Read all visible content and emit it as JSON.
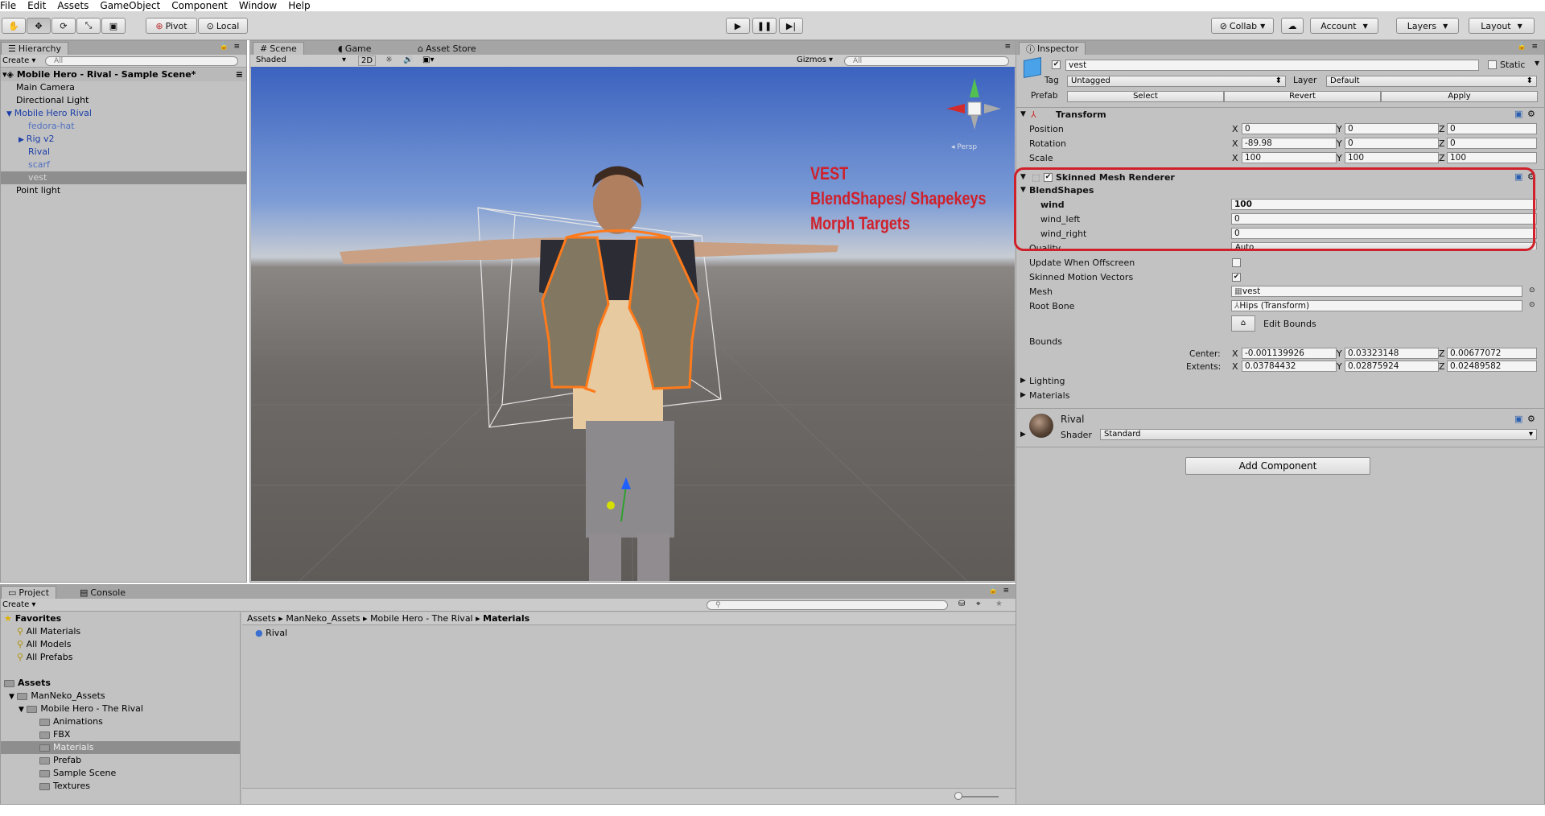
{
  "menu": [
    "File",
    "Edit",
    "Assets",
    "GameObject",
    "Component",
    "Window",
    "Help"
  ],
  "toolbar": {
    "pivot": "Pivot",
    "local": "Local",
    "collab": "Collab",
    "account": "Account",
    "layers": "Layers",
    "layout": "Layout"
  },
  "hierarchy": {
    "tab": "Hierarchy",
    "create": "Create",
    "search_placeholder": "All",
    "scene": "Mobile Hero - Rival - Sample Scene*",
    "items": [
      "Main Camera",
      "Directional Light",
      "Mobile Hero Rival",
      "fedora-hat",
      "Rig v2",
      "Rival",
      "scarf",
      "vest",
      "Point light"
    ]
  },
  "scene": {
    "tab_scene": "Scene",
    "tab_game": "Game",
    "tab_store": "Asset Store",
    "shading": "Shaded",
    "mode2d": "2D",
    "gizmos": "Gizmos",
    "search_placeholder": "All",
    "persp": "Persp",
    "annotation": [
      "VEST",
      "BlendShapes/ Shapekeys",
      "Morph Targets"
    ],
    "annotation_color": "#d0202a",
    "outline_color": "#ff7a1a"
  },
  "inspector": {
    "tab": "Inspector",
    "object_name": "vest",
    "static_label": "Static",
    "tag_label": "Tag",
    "tag_value": "Untagged",
    "layer_label": "Layer",
    "layer_value": "Default",
    "prefab_label": "Prefab",
    "prefab_buttons": [
      "Select",
      "Revert",
      "Apply"
    ],
    "transform": {
      "title": "Transform",
      "rows": [
        {
          "label": "Position",
          "x": "0",
          "y": "0",
          "z": "0"
        },
        {
          "label": "Rotation",
          "x": "-89.98",
          "y": "0",
          "z": "0"
        },
        {
          "label": "Scale",
          "x": "100",
          "y": "100",
          "z": "100"
        }
      ]
    },
    "smr": {
      "title": "Skinned Mesh Renderer",
      "blendshapes_label": "BlendShapes",
      "blendshapes": [
        {
          "name": "wind",
          "value": "100"
        },
        {
          "name": "wind_left",
          "value": "0"
        },
        {
          "name": "wind_right",
          "value": "0"
        }
      ],
      "quality_label": "Quality",
      "quality_value": "Auto",
      "update_offscreen": "Update When Offscreen",
      "skinned_motion": "Skinned Motion Vectors",
      "mesh_label": "Mesh",
      "mesh_value": "vest",
      "root_bone_label": "Root Bone",
      "root_bone_value": "Hips (Transform)",
      "edit_bounds": "Edit Bounds",
      "bounds_label": "Bounds",
      "center_label": "Center:",
      "center": {
        "x": "-0.001139926",
        "y": "0.03323148",
        "z": "0.00677072"
      },
      "extents_label": "Extents:",
      "extents": {
        "x": "0.03784432",
        "y": "0.02875924",
        "z": "0.02489582"
      },
      "lighting": "Lighting",
      "materials": "Materials"
    },
    "material": {
      "name": "Rival",
      "shader_label": "Shader",
      "shader_value": "Standard"
    },
    "add_component": "Add Component",
    "highlight_color": "#d0202a"
  },
  "project": {
    "tab": "Project",
    "console_tab": "Console",
    "create": "Create",
    "favorites": "Favorites",
    "favorite_items": [
      "All Materials",
      "All Models",
      "All Prefabs"
    ],
    "assets": "Assets",
    "tree": [
      "ManNeko_Assets",
      "Mobile Hero - The Rival",
      "Animations",
      "FBX",
      "Materials",
      "Prefab",
      "Sample Scene",
      "Textures"
    ],
    "breadcrumb": [
      "Assets",
      "ManNeko_Assets",
      "Mobile Hero - The Rival",
      "Materials"
    ],
    "files": [
      "Rival"
    ]
  }
}
